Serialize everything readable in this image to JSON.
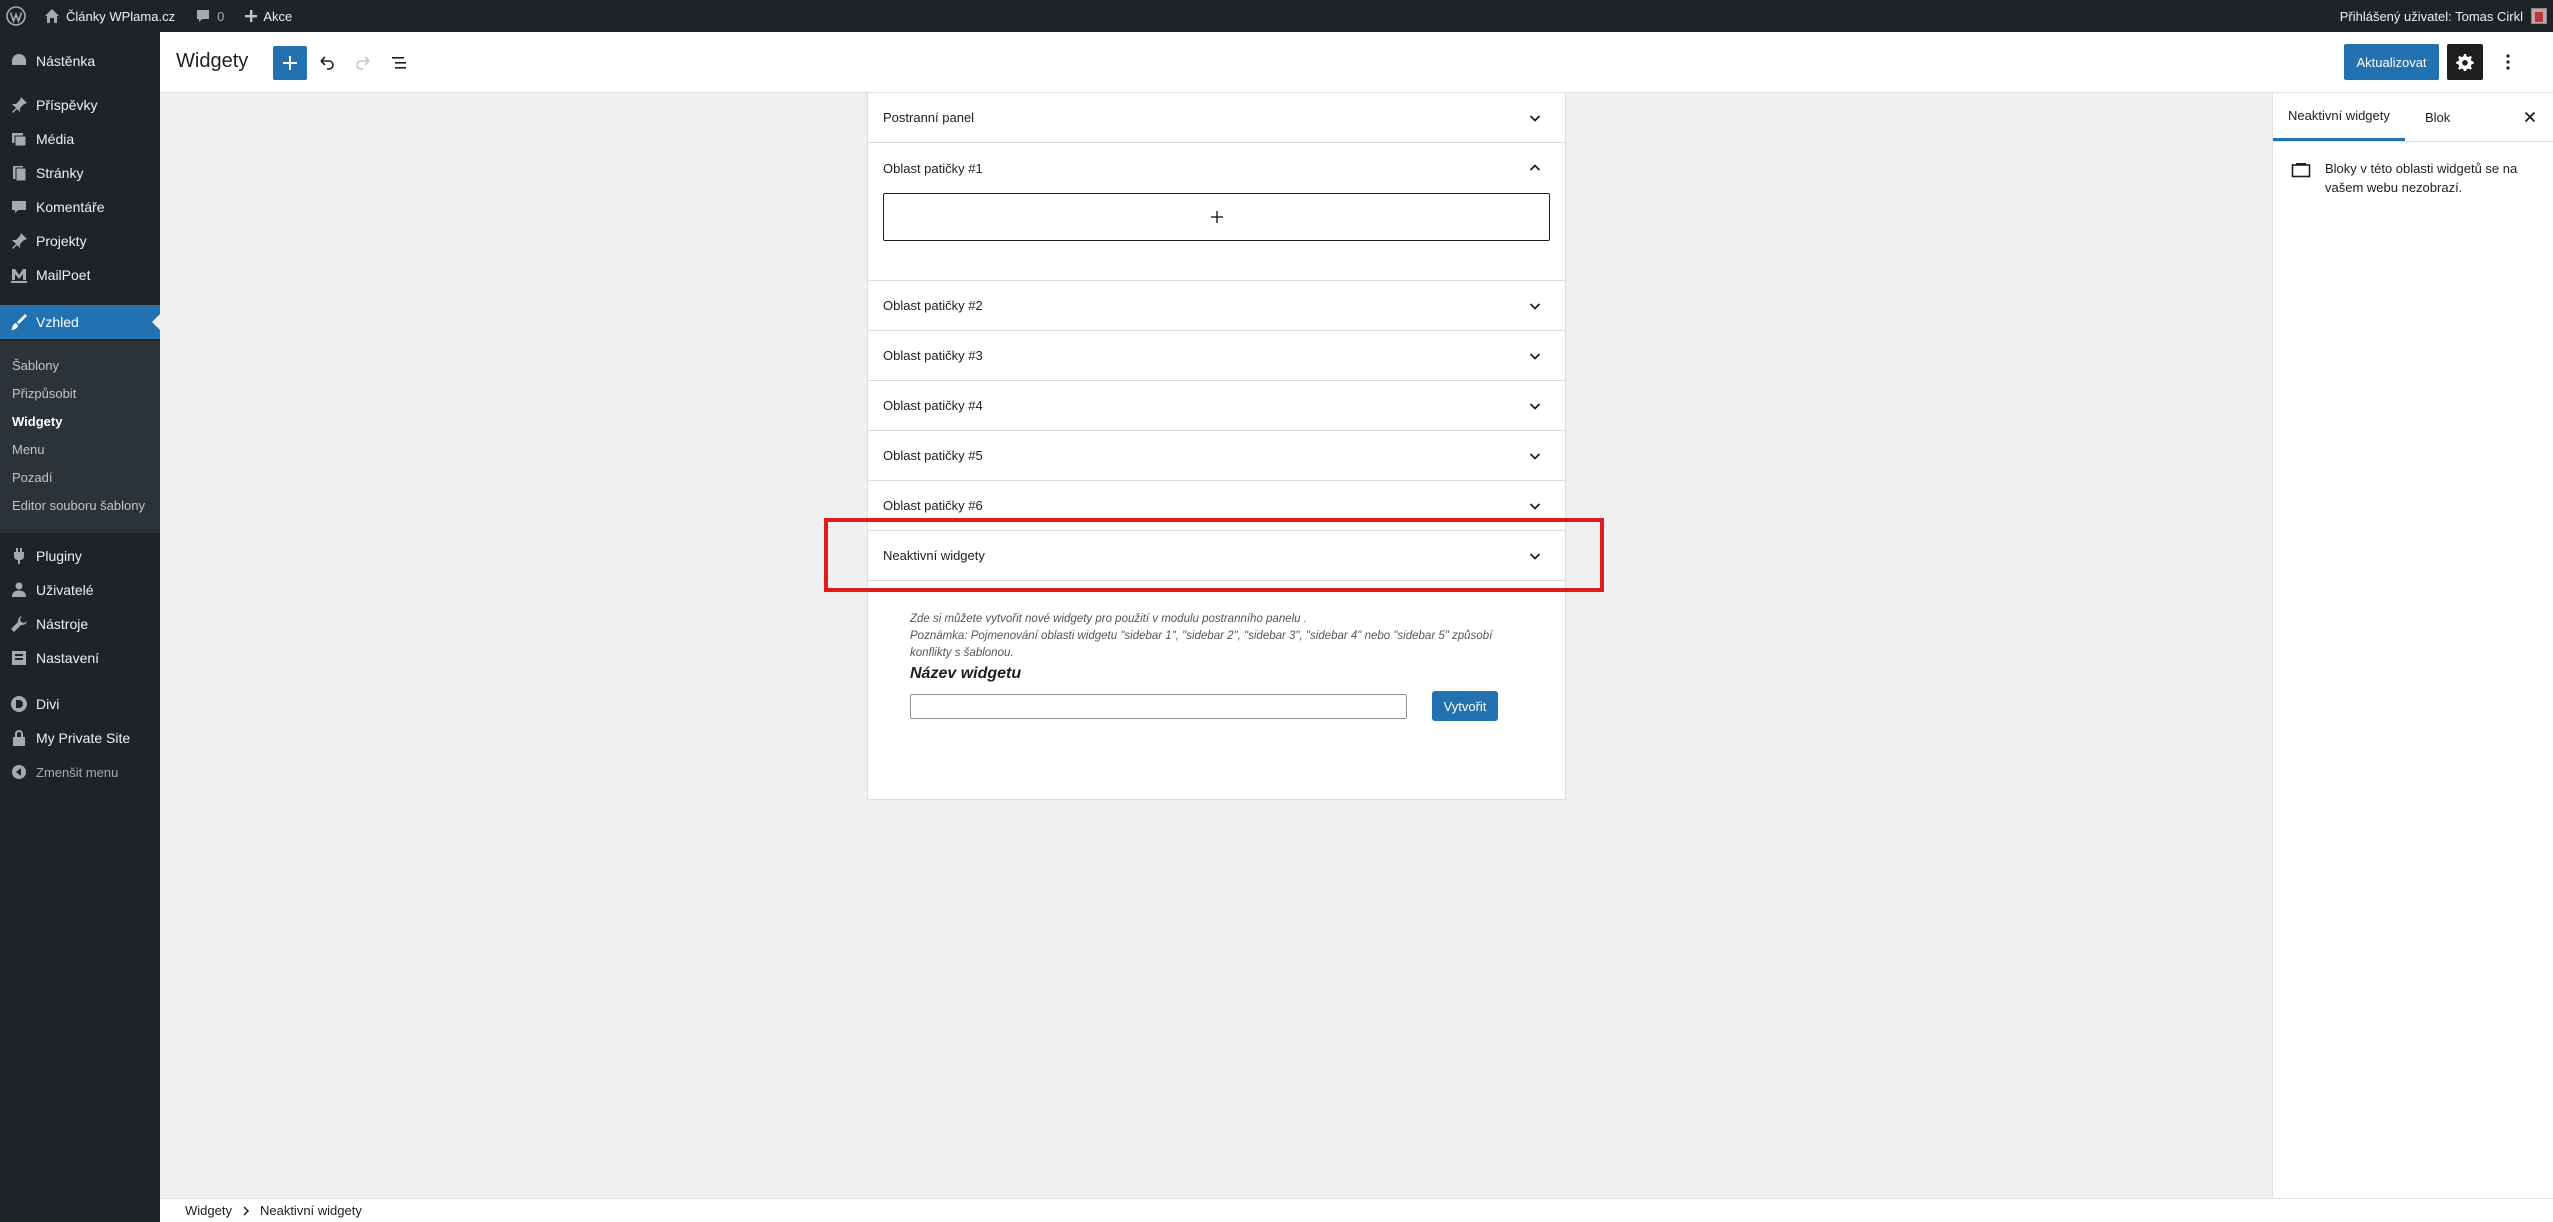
{
  "adminbar": {
    "site_name": "Články WPlama.cz",
    "comments_count": "0",
    "new_label": "Akce",
    "greeting": "Přihlášený uživatel: Tomas Cirkl"
  },
  "sidebar": {
    "items": [
      {
        "label": "Nástěnka",
        "icon": "dashboard-icon"
      },
      {
        "label": "Příspěvky",
        "icon": "pin-icon"
      },
      {
        "label": "Média",
        "icon": "media-icon"
      },
      {
        "label": "Stránky",
        "icon": "pages-icon"
      },
      {
        "label": "Komentáře",
        "icon": "comment-icon"
      },
      {
        "label": "Projekty",
        "icon": "pin-icon"
      },
      {
        "label": "MailPoet",
        "icon": "mailpoet-icon"
      },
      {
        "label": "Vzhled",
        "icon": "brush-icon"
      },
      {
        "label": "Pluginy",
        "icon": "plugin-icon"
      },
      {
        "label": "Uživatelé",
        "icon": "users-icon"
      },
      {
        "label": "Nástroje",
        "icon": "tools-icon"
      },
      {
        "label": "Nastavení",
        "icon": "settings-icon"
      },
      {
        "label": "Divi",
        "icon": "divi-icon"
      },
      {
        "label": "My Private Site",
        "icon": "lock-icon"
      },
      {
        "label": "Zmenšit menu",
        "icon": "collapse-icon"
      }
    ],
    "submenu": [
      "Šablony",
      "Přizpůsobit",
      "Widgety",
      "Menu",
      "Pozadí",
      "Editor souboru šablony"
    ]
  },
  "header": {
    "title": "Widgety",
    "update_label": "Aktualizovat"
  },
  "areas": [
    {
      "label": "Postranní panel",
      "open": false
    },
    {
      "label": "Oblast patičky #1",
      "open": true
    },
    {
      "label": "Oblast patičky #2",
      "open": false
    },
    {
      "label": "Oblast patičky #3",
      "open": false
    },
    {
      "label": "Oblast patičky #4",
      "open": false
    },
    {
      "label": "Oblast patičky #5",
      "open": false
    },
    {
      "label": "Oblast patičky #6",
      "open": false
    },
    {
      "label": "Neaktivní widgety",
      "open": false
    }
  ],
  "legacy": {
    "desc_line1": "Zde si můžete vytvořit nové widgety pro použití v modulu postranního panelu .",
    "desc_line2": "Poznámka: Pojmenování oblasti widgetu \"sidebar 1\", \"sidebar 2\", \"sidebar 3\", \"sidebar 4\" nebo \"sidebar 5\" způsobí konflikty s šablonou.",
    "name_heading": "Název widgetu",
    "create_label": "Vytvořit"
  },
  "settings": {
    "tab_active": "Neaktivní widgety",
    "tab_block": "Blok",
    "info": "Bloky v této oblasti widgetů se na vašem webu nezobrazí."
  },
  "footer": {
    "crumb1": "Widgety",
    "crumb2": "Neaktivní widgety"
  },
  "colors": {
    "accent": "#2271b1",
    "admin_dark": "#1d2327",
    "highlight": "#e01b1b"
  }
}
